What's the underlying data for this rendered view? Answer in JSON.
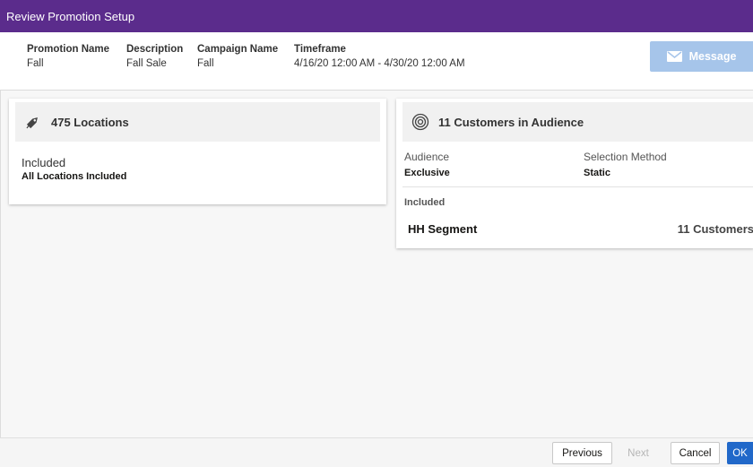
{
  "dialog": {
    "title": "Review Promotion Setup"
  },
  "summary": {
    "promotion_name": {
      "label": "Promotion Name",
      "value": "Fall"
    },
    "description": {
      "label": "Description",
      "value": "Fall Sale"
    },
    "campaign_name": {
      "label": "Campaign Name",
      "value": "Fall"
    },
    "timeframe": {
      "label": "Timeframe",
      "value": "4/16/20 12:00 AM - 4/30/20 12:00 AM"
    },
    "message_button": {
      "label": "Message",
      "icon": "envelope-icon"
    }
  },
  "locations_card": {
    "title": "475 Locations",
    "icon": "tag-icon",
    "status_label": "Included",
    "status_value": "All Locations Included"
  },
  "audience_card": {
    "title": "11 Customers in Audience",
    "icon": "target-icon",
    "audience_label": "Audience",
    "audience_value": "Exclusive",
    "selection_method_label": "Selection Method",
    "selection_method_value": "Static",
    "included_label": "Included",
    "segment_name": "HH Segment",
    "segment_count": "11 Customers"
  },
  "footer": {
    "previous": "Previous",
    "next": "Next",
    "cancel": "Cancel",
    "ok": "OK"
  },
  "colors": {
    "titlebar": "#5b2c8c",
    "message_button": "#a6c5ea",
    "primary_button": "#2168c9"
  }
}
